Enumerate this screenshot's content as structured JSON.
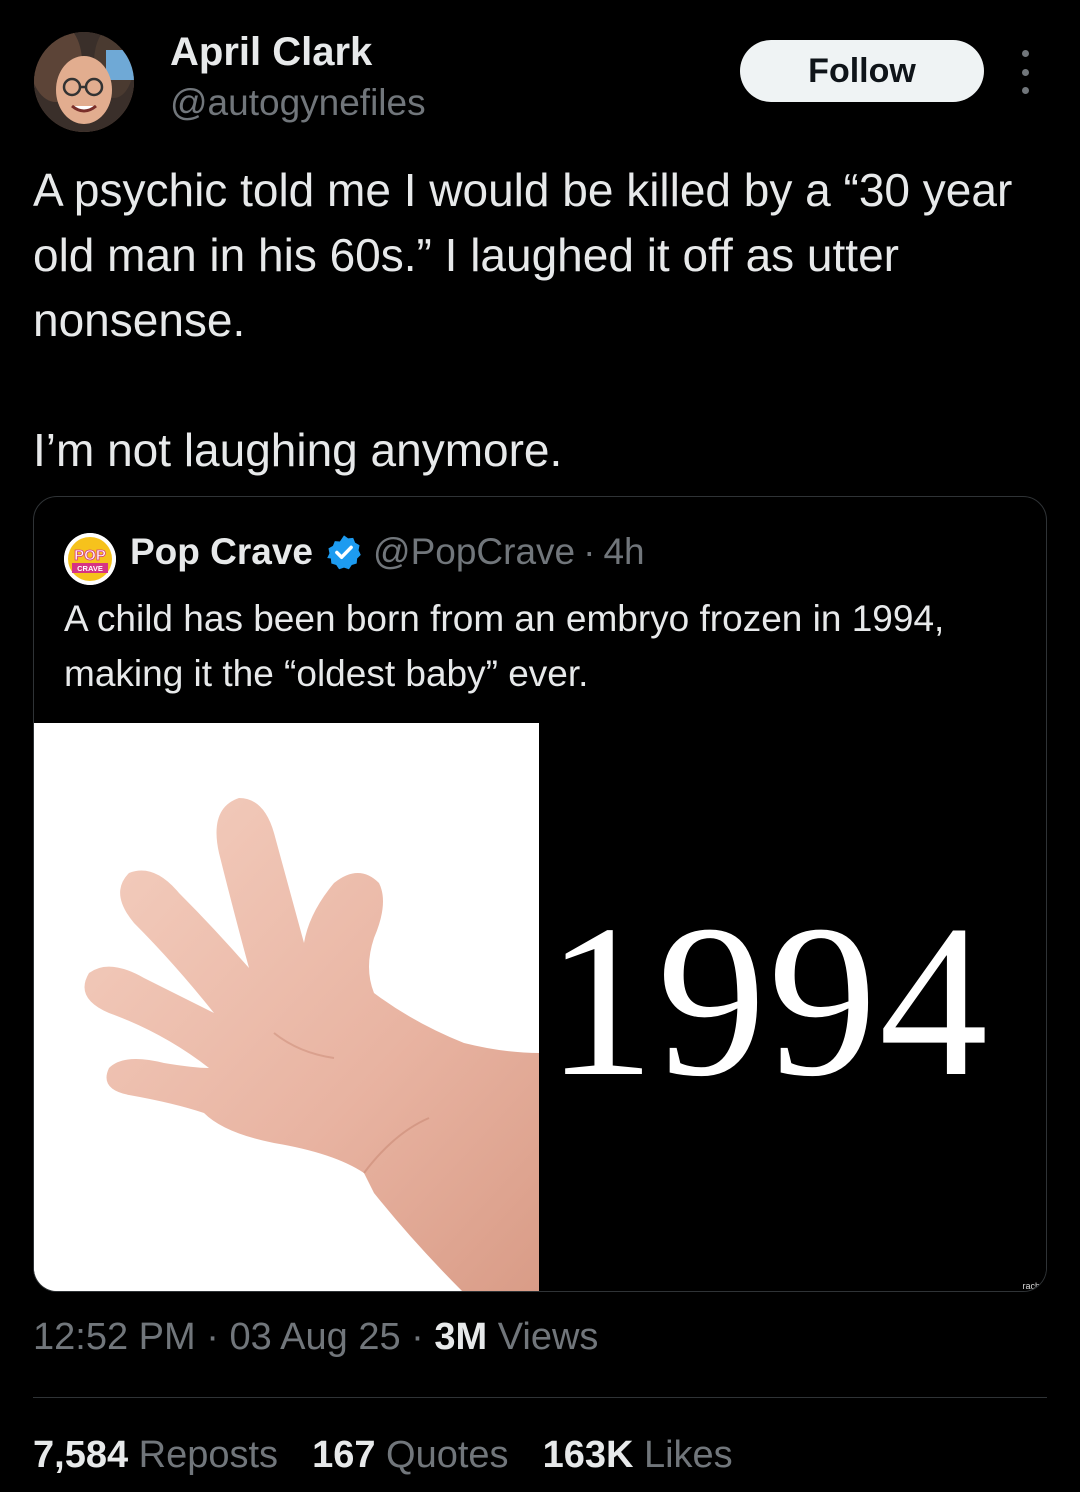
{
  "author": {
    "name": "April Clark",
    "handle": "@autogynefiles",
    "avatar_icon": "profile-photo"
  },
  "follow_label": "Follow",
  "more_icon": "more-vertical-icon",
  "tweet": {
    "paragraph_1": "A psychic told me I would be killed by a “30 year old man in his 60s.” I laughed it off as utter nonsense.",
    "paragraph_2": "I’m not laughing anymore."
  },
  "quoted": {
    "name": "Pop Crave",
    "avatar_text_top": "POP",
    "avatar_text_bottom": "CRAVE",
    "verified_icon": "verified-badge-icon",
    "verified_color": "#1d9bf0",
    "handle": "@PopCrave",
    "separator": "·",
    "time": "4h",
    "text": "A child has been born from an embryo frozen in 1994, making it the “oldest baby” ever.",
    "media": {
      "year_text": "1994",
      "credit": "rach"
    }
  },
  "meta": {
    "time": "12:52 PM",
    "sep1": "·",
    "date": "03 Aug 25",
    "sep2": "·",
    "views_count": "3M",
    "views_label": "Views"
  },
  "stats": {
    "reposts_count": "7,584",
    "reposts_label": "Reposts",
    "quotes_count": "167",
    "quotes_label": "Quotes",
    "likes_count": "163K",
    "likes_label": "Likes"
  }
}
